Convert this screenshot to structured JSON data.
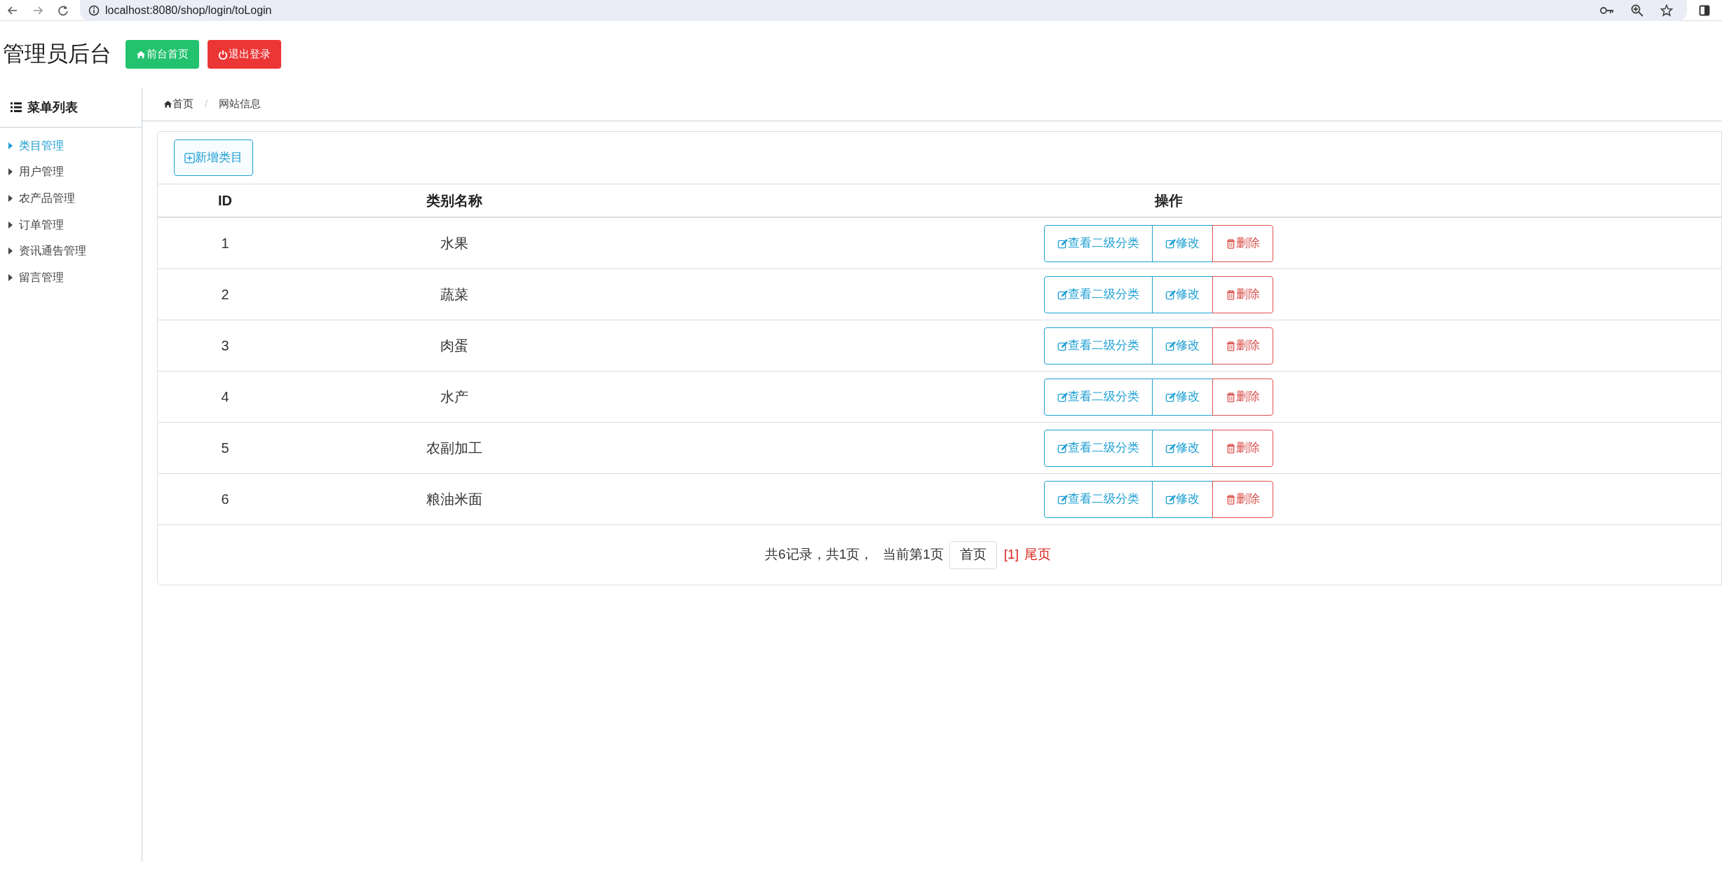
{
  "browser": {
    "url": "localhost:8080/shop/login/toLogin"
  },
  "header": {
    "title": "管理员后台",
    "buttons": [
      {
        "kind": "home",
        "label": "前台首页"
      },
      {
        "kind": "logout",
        "label": "退出登录"
      }
    ]
  },
  "sidebar": {
    "title": "菜单列表",
    "items": [
      {
        "label": "类目管理",
        "selected": true
      },
      {
        "label": "用户管理",
        "selected": false
      },
      {
        "label": "农产品管理",
        "selected": false
      },
      {
        "label": "订单管理",
        "selected": false
      },
      {
        "label": "资讯通告管理",
        "selected": false
      },
      {
        "label": "留言管理",
        "selected": false
      }
    ]
  },
  "breadcrumb": [
    {
      "kind": "home",
      "label": "首页"
    },
    {
      "kind": "separator",
      "label": "/"
    },
    {
      "kind": "page",
      "label": "网站信息"
    }
  ],
  "add_button": "新增类目",
  "table": {
    "columns": [
      "ID",
      "类别名称",
      "操作"
    ],
    "rows": [
      {
        "id": "1",
        "name": "水果",
        "actions": [
          {
            "kind": "view",
            "label": "查看二级分类"
          },
          {
            "kind": "edit",
            "label": "修改"
          },
          {
            "kind": "delete",
            "label": "删除"
          }
        ]
      },
      {
        "id": "2",
        "name": "蔬菜",
        "actions": [
          {
            "kind": "view",
            "label": "查看二级分类"
          },
          {
            "kind": "edit",
            "label": "修改"
          },
          {
            "kind": "delete",
            "label": "删除"
          }
        ]
      },
      {
        "id": "3",
        "name": "肉蛋",
        "actions": [
          {
            "kind": "view",
            "label": "查看二级分类"
          },
          {
            "kind": "edit",
            "label": "修改"
          },
          {
            "kind": "delete",
            "label": "删除"
          }
        ]
      },
      {
        "id": "4",
        "name": "水产",
        "actions": [
          {
            "kind": "view",
            "label": "查看二级分类"
          },
          {
            "kind": "edit",
            "label": "修改"
          },
          {
            "kind": "delete",
            "label": "删除"
          }
        ]
      },
      {
        "id": "5",
        "name": "农副加工",
        "actions": [
          {
            "kind": "view",
            "label": "查看二级分类"
          },
          {
            "kind": "edit",
            "label": "修改"
          },
          {
            "kind": "delete",
            "label": "删除"
          }
        ]
      },
      {
        "id": "6",
        "name": "粮油米面",
        "actions": [
          {
            "kind": "view",
            "label": "查看二级分类"
          },
          {
            "kind": "edit",
            "label": "修改"
          },
          {
            "kind": "delete",
            "label": "删除"
          }
        ]
      }
    ]
  },
  "pagination": {
    "summary": "共6记录，共1页，",
    "current": "当前第1页",
    "first": "首页",
    "page": "[1]",
    "last": "尾页"
  }
}
